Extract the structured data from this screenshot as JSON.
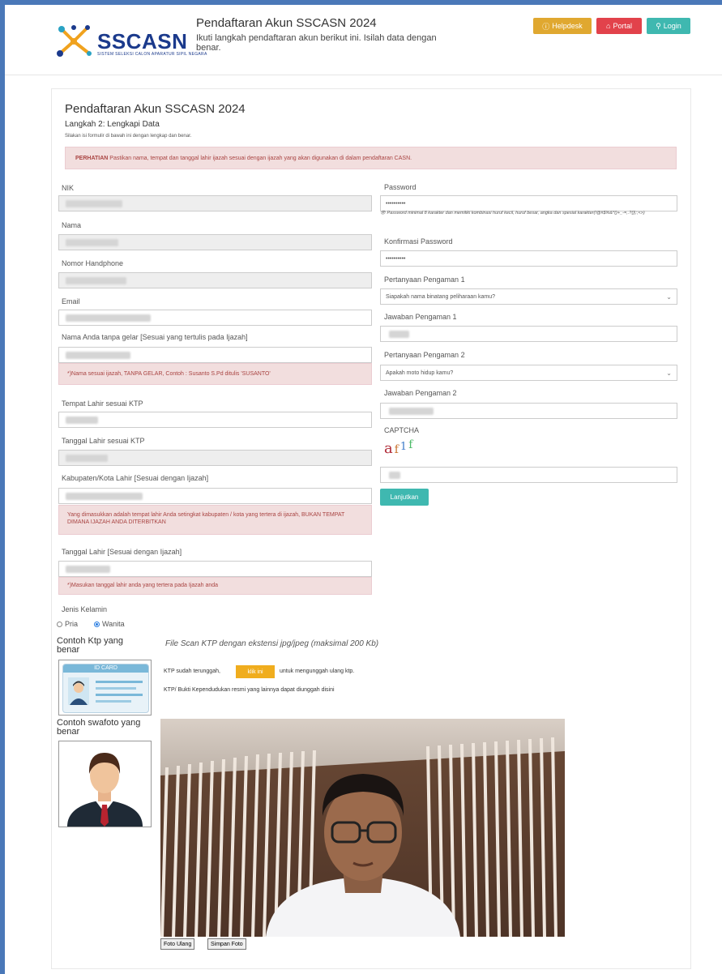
{
  "header": {
    "logo_text": "SSCASN",
    "logo_sub": "SISTEM SELEKSI CALON APARATUR SIPIL NEGARA",
    "title": "Pendaftaran Akun SSCASN 2024",
    "description": "Ikuti langkah pendaftaran akun berikut ini. Isilah data dengan benar.",
    "buttons": {
      "helpdesk": "Helpdesk",
      "portal": "Portal",
      "login": "Login"
    },
    "colors": {
      "helpdesk": "#e0a830",
      "portal": "#e2424b",
      "login": "#3fb8b0"
    }
  },
  "form": {
    "title": "Pendaftaran Akun SSCASN 2024",
    "step": "Langkah 2: Lengkapi Data",
    "info": "Silakan isi formulir di bawah ini dengan lengkap dan benar.",
    "alert_strong": "PERHATIAN",
    "alert_text": " Pastikan nama, tempat dan tanggal lahir ijazah sesuai dengan ijazah yang akan digunakan di dalam pendaftaran CASN.",
    "left": {
      "nik_label": "NIK",
      "nama_label": "Nama",
      "hp_label": "Nomor Handphone",
      "email_label": "Email",
      "nama_ijazah_label": "Nama Anda tanpa gelar [Sesuai yang tertulis pada Ijazah]",
      "nama_ijazah_note": "*)Nama sesuai ijazah, TANPA GELAR, Contoh : Susanto S.Pd ditulis 'SUSANTO'",
      "tempat_lahir_label": "Tempat Lahir sesuai KTP",
      "tanggal_lahir_label": "Tanggal Lahir sesuai KTP",
      "kab_label": "Kabupaten/Kota Lahir [Sesuai dengan Ijazah]",
      "kab_note": "Yang dimasukkan adalah tempat lahir Anda setingkat kabupaten / kota yang tertera di ijazah, BUKAN TEMPAT DIMANA IJAZAH ANDA DITERBITKAN",
      "tgl_ijazah_label": "Tanggal Lahir [Sesuai dengan Ijazah]",
      "tgl_ijazah_note": "*)Masukan tanggal lahir anda yang tertera pada Ijazah anda",
      "gender_label": "Jenis Kelamin",
      "gender_options": [
        "Pria",
        "Wanita"
      ],
      "gender_selected": "Wanita"
    },
    "right": {
      "password_label": "Password",
      "password_value": "••••••••••",
      "password_hint": "Password minimal 8 karakter dan memiliki kombinasi huruf kecil, huruf besar, angka dan spesial karakter(!@#$%&*()+_-=,.?{}|:;<>)",
      "konfirmasi_label": "Konfirmasi Password",
      "konfirmasi_value": "••••••••••",
      "q1_label": "Pertanyaan Pengaman 1",
      "q1_value": "Siapakah nama binatang peliharaan kamu?",
      "a1_label": "Jawaban Pengaman 1",
      "q2_label": "Pertanyaan Pengaman 2",
      "q2_value": "Apakah moto hidup kamu?",
      "a2_label": "Jawaban Pengaman 2",
      "captcha_label": "CAPTCHA",
      "captcha_text": "af1f",
      "submit": "Lanjutkan"
    },
    "uploads": {
      "ktp_example_label": "Contoh Ktp yang benar",
      "ktp_card_title": "ID CARD",
      "ktp_file_label": "File Scan KTP dengan ekstensi jpg/jpeg (maksimal 200 Kb)",
      "ktp_uploaded_pre": "KTP sudah terunggah,",
      "ktp_klik": "klik ini",
      "ktp_uploaded_post": "untuk mengunggah ulang ktp.",
      "ktp_other": "KTP/ Bukti Kependudukan resmi yang lainnya dapat diunggah disini",
      "selfie_example_label": "Contoh swafoto yang benar",
      "foto_ulang": "Foto Ulang",
      "simpan_foto": "Simpan Foto"
    }
  }
}
